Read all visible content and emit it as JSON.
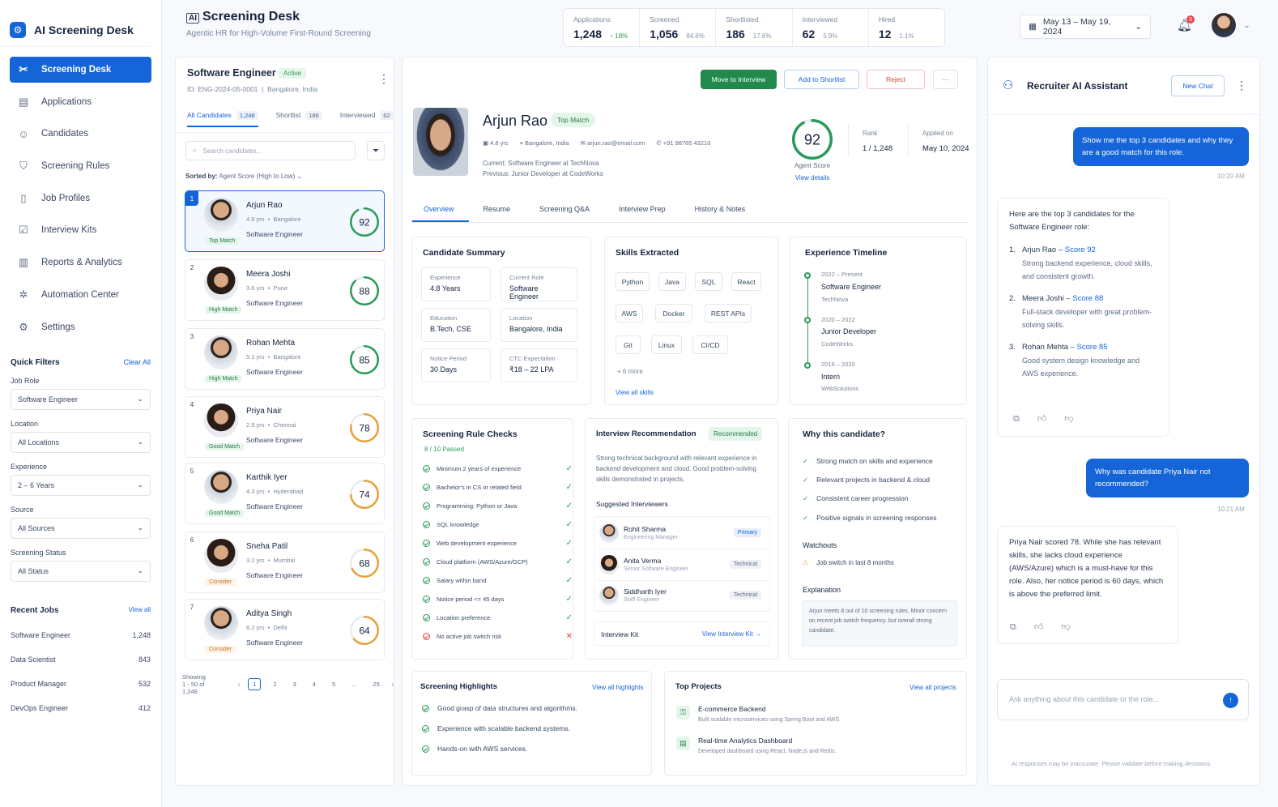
{
  "app": {
    "name": "AI Screening Desk",
    "title": "Screening Desk",
    "subtitle": "Agentic HR for High-Volume First-Round Screening"
  },
  "sidebar": {
    "nav": [
      "Screening Desk",
      "Applications",
      "Candidates",
      "Screening Rules",
      "Job Profiles",
      "Interview Kits",
      "Reports & Analytics",
      "Automation Center",
      "Settings"
    ],
    "quick_filters": {
      "title": "Quick Filters",
      "clear": "Clear All",
      "fields": [
        {
          "label": "Job Role",
          "value": "Software Engineer"
        },
        {
          "label": "Location",
          "value": "All Locations"
        },
        {
          "label": "Experience",
          "value": "2 – 6 Years"
        },
        {
          "label": "Source",
          "value": "All Sources"
        },
        {
          "label": "Screening Status",
          "value": "All Status"
        }
      ]
    },
    "recent_jobs": {
      "title": "Recent Jobs",
      "view_all": "View all",
      "items": [
        {
          "name": "Software Engineer",
          "count": "1,248"
        },
        {
          "name": "Data Scientist",
          "count": "843"
        },
        {
          "name": "Product Manager",
          "count": "532"
        },
        {
          "name": "DevOps Engineer",
          "count": "412"
        }
      ]
    }
  },
  "stats": [
    {
      "label": "Applications",
      "value": "1,248",
      "delta": "↑ 18%"
    },
    {
      "label": "Screened",
      "value": "1,056",
      "delta": "84.6%"
    },
    {
      "label": "Shortlisted",
      "value": "186",
      "delta": "17.6%"
    },
    {
      "label": "Interviewed",
      "value": "62",
      "delta": "5.9%"
    },
    {
      "label": "Hired",
      "value": "12",
      "delta": "1.1%"
    }
  ],
  "header": {
    "date_range": "May 13 – May 19, 2024",
    "notifications": "3"
  },
  "job": {
    "title": "Software Engineer",
    "status": "Active",
    "id": "ID: ENG-2024-05-0001",
    "location": "Bangalore, India"
  },
  "list_tabs": [
    {
      "label": "All Candidates",
      "count": "1,248"
    },
    {
      "label": "Shortlist",
      "count": "186"
    },
    {
      "label": "Interviewed",
      "count": "62"
    }
  ],
  "search": {
    "placeholder": "Search candidates..."
  },
  "sorted": {
    "label": "Sorted by:",
    "value": "Agent Score (High to Low)"
  },
  "candidates": [
    {
      "rank": "1",
      "name": "Arjun Rao",
      "exp": "4.8 yrs",
      "loc": "Bangalore",
      "role": "Software Engineer",
      "score": 92,
      "tag": "Top Match",
      "g": "m"
    },
    {
      "rank": "2",
      "name": "Meera Joshi",
      "exp": "3.6 yrs",
      "loc": "Pune",
      "role": "Software Engineer",
      "score": 88,
      "tag": "High Match",
      "g": "f"
    },
    {
      "rank": "3",
      "name": "Rohan Mehta",
      "exp": "5.1 yrs",
      "loc": "Bangalore",
      "role": "Software Engineer",
      "score": 85,
      "tag": "High Match",
      "g": "m"
    },
    {
      "rank": "4",
      "name": "Priya Nair",
      "exp": "2.9 yrs",
      "loc": "Chennai",
      "role": "Software Engineer",
      "score": 78,
      "tag": "Good Match",
      "g": "f"
    },
    {
      "rank": "5",
      "name": "Karthik Iyer",
      "exp": "4.3 yrs",
      "loc": "Hyderabad",
      "role": "Software Engineer",
      "score": 74,
      "tag": "Good Match",
      "g": "m"
    },
    {
      "rank": "6",
      "name": "Sneha Patil",
      "exp": "3.2 yrs",
      "loc": "Mumbai",
      "role": "Software Engineer",
      "score": 68,
      "tag": "Consider",
      "g": "f"
    },
    {
      "rank": "7",
      "name": "Aditya Singh",
      "exp": "6.2 yrs",
      "loc": "Delhi",
      "role": "Software Engineer",
      "score": 64,
      "tag": "Consider",
      "g": "m"
    }
  ],
  "pagination": {
    "showing": "Showing 1 - 50 of 1,248",
    "pages": [
      "1",
      "2",
      "3",
      "4",
      "5",
      "...",
      "25"
    ]
  },
  "actions": {
    "interview": "Move to Interview",
    "shortlist": "Add to Shortlist",
    "reject": "Reject",
    "more": "···"
  },
  "profile": {
    "name": "Arjun Rao",
    "badge": "Top Match",
    "exp": "4.8 yrs",
    "loc": "Bangalore, India",
    "email": "arjun.rao@email.com",
    "phone": "+91 98765 43210",
    "current": "Current: Software Engineer at TechNova",
    "previous": "Previous: Junior Developer at CodeWorks",
    "score": 92,
    "score_label": "Agent Score",
    "view_details": "View details",
    "rank_label": "Rank",
    "rank": "1  /  1,248",
    "applied_label": "Applied on",
    "applied": "May 10, 2024"
  },
  "detail_tabs": [
    "Overview",
    "Resume",
    "Screening Q&A",
    "Interview Prep",
    "History & Notes"
  ],
  "summary": {
    "title": "Candidate Summary",
    "items": [
      {
        "label": "Experience",
        "value": "4.8 Years"
      },
      {
        "label": "Current Role",
        "value": "Software Engineer"
      },
      {
        "label": "Education",
        "value": "B.Tech, CSE"
      },
      {
        "label": "Location",
        "value": "Bangalore, India"
      },
      {
        "label": "Notice Period",
        "value": "30 Days"
      },
      {
        "label": "CTC Expectation",
        "value": "₹18 – 22 LPA"
      }
    ]
  },
  "skills": {
    "title": "Skills Extracted",
    "items": [
      "Python",
      "Java",
      "SQL",
      "React",
      "AWS",
      "Docker",
      "REST APIs",
      "Git",
      "Linux",
      "CI/CD"
    ],
    "more": "+ 6 more",
    "view_all": "View all skills"
  },
  "timeline": {
    "title": "Experience Timeline",
    "items": [
      {
        "dates": "2022 – Present",
        "title": "Software Engineer",
        "company": "TechNova"
      },
      {
        "dates": "2020 – 2022",
        "title": "Junior Developer",
        "company": "CodeWorks"
      },
      {
        "dates": "2019 – 2020",
        "title": "Intern",
        "company": "WebSolutions"
      }
    ]
  },
  "rules": {
    "title": "Screening Rule Checks",
    "passed": "8 / 10 Passed",
    "items": [
      {
        "text": "Minimum 2 years of experience",
        "ok": true
      },
      {
        "text": "Bachelor's in CS or related field",
        "ok": true
      },
      {
        "text": "Programming: Python or Java",
        "ok": true
      },
      {
        "text": "SQL knowledge",
        "ok": true
      },
      {
        "text": "Web development experience",
        "ok": true
      },
      {
        "text": "Cloud platform (AWS/Azure/GCP)",
        "ok": true
      },
      {
        "text": "Salary within band",
        "ok": true
      },
      {
        "text": "Notice period <= 45 days",
        "ok": true
      },
      {
        "text": "Location preference",
        "ok": true
      },
      {
        "text": "No active job switch risk",
        "ok": false
      }
    ]
  },
  "recommendation": {
    "title": "Interview Recommendation",
    "badge": "Recommended",
    "text": "Strong technical background with relevant experience in backend development and cloud. Good problem-solving skills demonstrated in projects.",
    "suggested": "Suggested Interviewers",
    "interviewers": [
      {
        "name": "Rohit Sharma",
        "role": "Engineering Manager",
        "tag": "Primary"
      },
      {
        "name": "Anita Verma",
        "role": "Senior Software Engineer",
        "tag": "Technical"
      },
      {
        "name": "Siddharth Iyer",
        "role": "Staff Engineer",
        "tag": "Technical"
      }
    ],
    "kit_label": "Interview Kit",
    "kit_link": "View Interview Kit →"
  },
  "why": {
    "title": "Why this candidate?",
    "items": [
      "Strong match on skills and experience",
      "Relevant projects in backend & cloud",
      "Consistent career progression",
      "Positive signals in screening responses"
    ],
    "watch_title": "Watchouts",
    "watch": "Job switch in last 8 months",
    "exp_title": "Explanation",
    "explanation": "Arjun meets 8 out of 10 screening rules. Minor concern on recent job switch frequency, but overall strong candidate."
  },
  "highlights": {
    "title": "Screening Highlights",
    "view_all": "View all highlights",
    "items": [
      "Good grasp of data structures and algorithms.",
      "Experience with scalable backend systems.",
      "Hands-on with AWS services."
    ]
  },
  "projects": {
    "title": "Top Projects",
    "view_all": "View all projects",
    "items": [
      {
        "name": "E-commerce Backend",
        "desc": "Built scalable microservices using Spring Boot and AWS."
      },
      {
        "name": "Real-time Analytics Dashboard",
        "desc": "Developed dashboard using React, Node.js and Redis."
      }
    ]
  },
  "assistant": {
    "title": "Recruiter AI Assistant",
    "new_chat": "New Chat",
    "q1": "Show me the top 3 candidates and why they are a good match for this role.",
    "t1": "10:20 AM",
    "a1_intro": "Here are the top 3 candidates for the Software Engineer role:",
    "a1_items": [
      {
        "n": "1.",
        "name": "Arjun Rao – ",
        "score": "Score 92",
        "desc": "Strong backend experience, cloud skills, and consistent growth."
      },
      {
        "n": "2.",
        "name": "Meera Joshi – ",
        "score": "Score 88",
        "desc": "Full-stack developer with great problem-solving skills."
      },
      {
        "n": "3.",
        "name": "Rohan Mehta – ",
        "score": "Score 85",
        "desc": "Good system design knowledge and AWS experience."
      }
    ],
    "q2": "Why was candidate Priya Nair not recommended?",
    "t2": "10:21 AM",
    "a2": "Priya Nair scored 78. While she has relevant skills, she lacks cloud experience (AWS/Azure) which is a must-have for this role. Also, her notice period is 60 days, which is above the preferred limit.",
    "placeholder": "Ask anything about this candidate or the role...",
    "disclaimer": "AI responses may be inaccurate. Please validate before making decisions."
  },
  "colors": {
    "primary": "#1565d8",
    "green": "#2a9a5a",
    "orange": "#e8a23a",
    "red": "#d8433f"
  }
}
